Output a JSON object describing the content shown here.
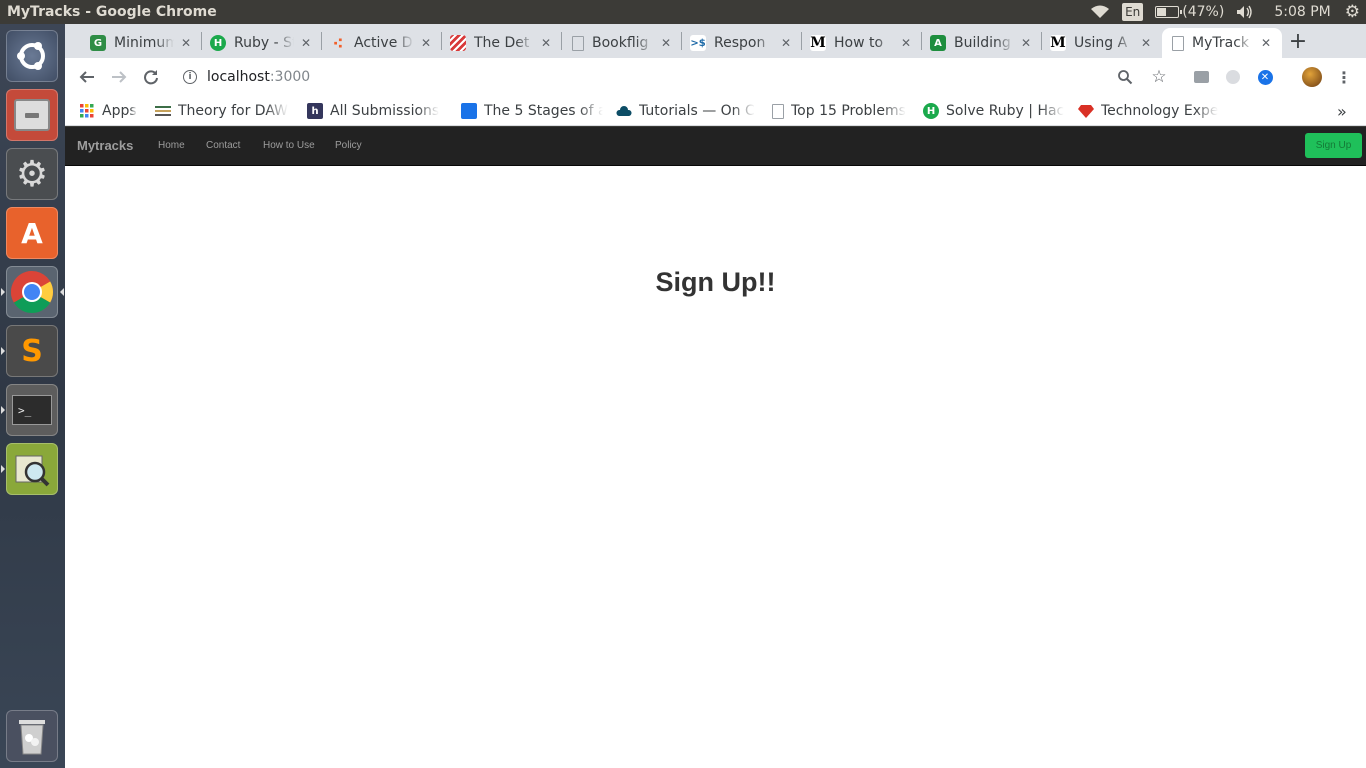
{
  "os_panel": {
    "window_title": "MyTracks - Google Chrome",
    "keyboard_layout": "En",
    "battery_percent": "(47%)",
    "battery_level": 0.47,
    "clock": "5:08 PM"
  },
  "launcher": {
    "apps": [
      "ubuntu-dash",
      "files",
      "system-settings",
      "ubuntu-software",
      "google-chrome",
      "sublime-text",
      "terminal",
      "system-monitor",
      "trash"
    ]
  },
  "browser": {
    "tabs": [
      {
        "title": "Minimum",
        "favicon": "geeksforgeeks-icon",
        "color": "#2f8d46"
      },
      {
        "title": "Ruby - St",
        "favicon": "hackerrank-icon",
        "color": "#1ba94c"
      },
      {
        "title": "Active D",
        "favicon": "active-icon",
        "color": "#f25f2a"
      },
      {
        "title": "The Det",
        "favicon": "stripes-icon",
        "color": "#d83a3a"
      },
      {
        "title": "Bookflig",
        "favicon": "document-icon",
        "color": "#9aa0a6"
      },
      {
        "title": "Respon",
        "favicon": "terminal-icon",
        "color": "#1e6aa8"
      },
      {
        "title": "How to",
        "favicon": "medium-icon",
        "color": "#111111"
      },
      {
        "title": "Building",
        "favicon": "android-icon",
        "color": "#1e8e3e"
      },
      {
        "title": "Using A",
        "favicon": "medium-icon",
        "color": "#111111"
      },
      {
        "title": "MyTrack",
        "favicon": "document-icon",
        "color": "#9aa0a6"
      }
    ],
    "active_tab": 9,
    "url_host": "localhost",
    "url_port": ":3000",
    "bookmarks": [
      {
        "label": "Apps",
        "icon": "apps-grid-icon",
        "color": "#ea4335"
      },
      {
        "label": "Theory for DAW",
        "icon": "stack-icon",
        "color": "#c5a15a"
      },
      {
        "label": "All Submissions",
        "icon": "h-icon",
        "color": "#34365c"
      },
      {
        "label": "The 5 Stages of a",
        "icon": "square-icon",
        "color": "#1a73e8"
      },
      {
        "label": "Tutorials — On C",
        "icon": "cloud-icon",
        "color": "#0d4d66"
      },
      {
        "label": "Top 15 Problems",
        "icon": "document-icon",
        "color": "#9aa0a6"
      },
      {
        "label": "Solve Ruby | Hac",
        "icon": "hackerrank-icon",
        "color": "#1ba94c"
      },
      {
        "label": "Technology Expe",
        "icon": "gem-icon",
        "color": "#d93025"
      }
    ],
    "more_bookmarks": "»"
  },
  "app": {
    "brand": "Mytracks",
    "nav": [
      "Home",
      "Contact",
      "How to Use",
      "Policy"
    ],
    "signup_button": "Sign Up",
    "heading": "Sign Up!!"
  }
}
